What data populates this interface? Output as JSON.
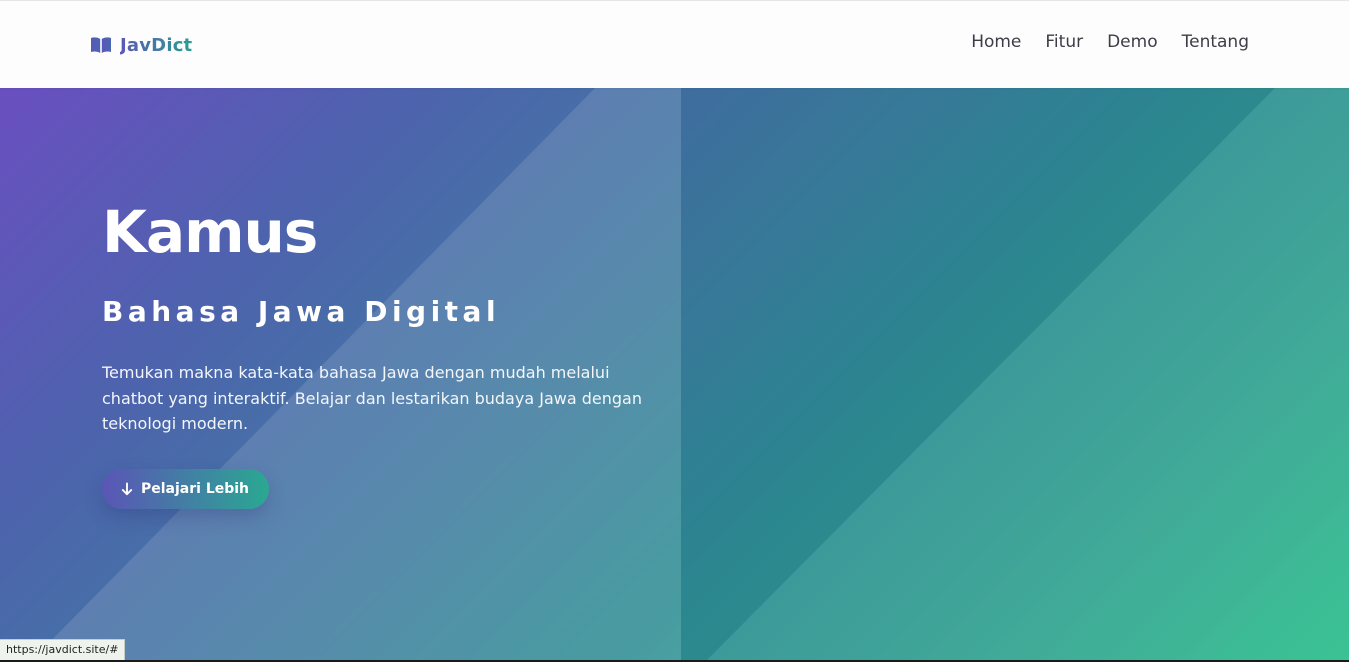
{
  "navbar": {
    "brand": {
      "icon": "open-book-icon",
      "name": "JavDict",
      "colors": {
        "start": "#5b58b8",
        "end": "#2a9d8f"
      }
    },
    "links": [
      "Home",
      "Fitur",
      "Demo",
      "Tentang"
    ]
  },
  "hero": {
    "title": "Kamus",
    "subtitle": "Bahasa Jawa Digital",
    "description": "Temukan makna kata-kata bahasa Jawa dengan mudah melalui chatbot yang interaktif. Belajar dan lestarikan budaya Jawa dengan teknologi modern.",
    "button": {
      "icon": "arrow-down-icon",
      "label": "Pelajari Lebih"
    },
    "colors": {
      "gradient_start": "#6a4fc0",
      "gradient_end": "#2ec08e"
    }
  },
  "status_bar": {
    "url": "https://javdict.site/#"
  }
}
